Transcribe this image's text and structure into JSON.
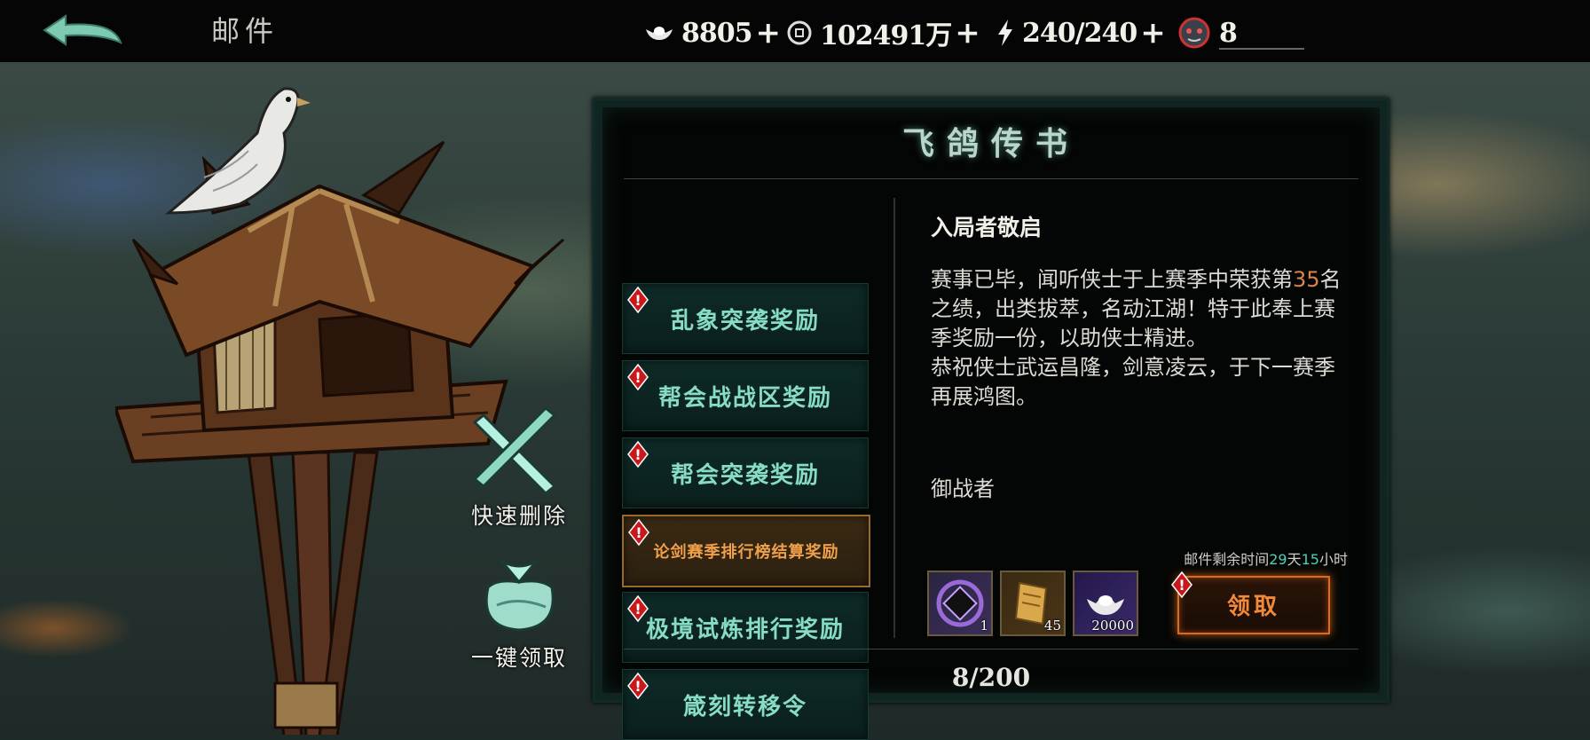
{
  "header": {
    "title": "邮件",
    "resources": [
      {
        "icon": "silver-ingot-icon",
        "value": "8805"
      },
      {
        "icon": "copper-coin-icon",
        "value": "102491万"
      },
      {
        "icon": "lightning-icon",
        "value": "240/240"
      },
      {
        "icon": "demon-mask-icon",
        "value": "8"
      }
    ],
    "plus": "+"
  },
  "side_actions": {
    "quick_delete": "快速删除",
    "claim_all": "一键领取"
  },
  "panel": {
    "title": "飞鸽传书",
    "mails": [
      {
        "label": "乱象突袭奖励",
        "active": false
      },
      {
        "label": "帮会战战区奖励",
        "active": false
      },
      {
        "label": "帮会突袭奖励",
        "active": false
      },
      {
        "label": "论剑赛季排行榜结算奖励",
        "active": true
      },
      {
        "label": "极境试炼排行奖励",
        "active": false
      },
      {
        "label": "箴刻转移令",
        "active": false
      }
    ],
    "mail": {
      "heading": "入局者敬启",
      "body_part1": "赛事已毕，闻听侠士于上赛季中荣获第",
      "rank": "35",
      "body_part2": "名之绩，出类拔萃，名动江湖！特于此奉上赛季奖励一份，以助侠士精进。",
      "body_part3": "恭祝侠士武运昌隆，剑意凌云，于下一赛季再展鸿图。",
      "sender": "御战者",
      "expire_prefix": "邮件剩余时间",
      "expire_days": "29",
      "expire_day_unit": "天",
      "expire_hours": "15",
      "expire_hour_unit": "小时",
      "rewards": [
        {
          "icon": "purple-frame-icon",
          "count": "1"
        },
        {
          "icon": "gold-token-icon",
          "count": "45"
        },
        {
          "icon": "silver-ingot-icon",
          "count": "20000"
        }
      ],
      "claim_label": "领取"
    },
    "page_count": "8/200"
  },
  "colors": {
    "accent_teal": "#86dcc4",
    "accent_orange": "#f0a04a",
    "claim_orange": "#e06a1a"
  }
}
